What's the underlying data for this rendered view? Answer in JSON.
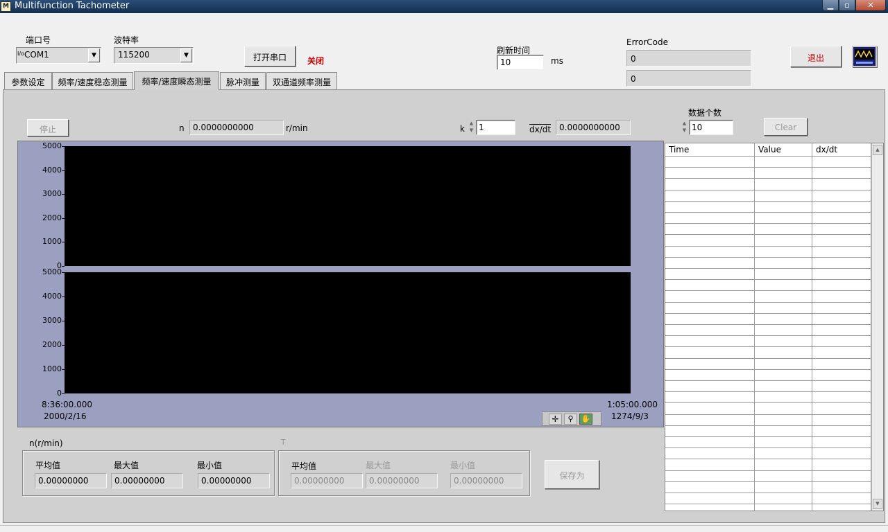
{
  "window": {
    "title": "Multifunction Tachometer",
    "icon_text": "M"
  },
  "colors": {
    "titlebar": "#1c3a5f",
    "chart_frame": "#9ba0c0",
    "plot_bg": "#000000",
    "alert_red": "#cc0000"
  },
  "port": {
    "port_label": "端口号",
    "port_prefix": "I/o",
    "port_value": "COM1",
    "baud_label": "波特率",
    "baud_value": "115200",
    "open_button": "打开串口",
    "status": "关闭"
  },
  "refresh": {
    "label": "刷新时间",
    "value": "10",
    "unit": "ms"
  },
  "error": {
    "label": "ErrorCode",
    "value1": "0",
    "value2": "0"
  },
  "exit_button": "退出",
  "tabs": [
    {
      "label": "参数设定"
    },
    {
      "label": "频率/速度稳态测量"
    },
    {
      "label": "频率/速度瞬态测量"
    },
    {
      "label": "脉冲测量"
    },
    {
      "label": "双通道频率测量"
    }
  ],
  "controls": {
    "stop_button": "停止",
    "n_label": "n",
    "n_value": "0.0000000000",
    "n_unit": "r/min",
    "k_label": "k",
    "k_value": "1",
    "dxdt_label": "dx/dt",
    "dxdt_value": "0.0000000000",
    "count_label": "数据个数",
    "count_value": "10",
    "clear_button": "Clear"
  },
  "chart_data": [
    {
      "type": "line",
      "ylim": [
        0,
        5000
      ],
      "yticks": [
        "5000",
        "4000",
        "3000",
        "2000",
        "1000",
        "0"
      ],
      "series": []
    },
    {
      "type": "line",
      "ylim": [
        0,
        5000
      ],
      "yticks": [
        "5000",
        "4000",
        "3000",
        "2000",
        "1000",
        "0"
      ],
      "x_start": "8:36:00.000",
      "x_start_date": "2000/2/16",
      "x_end": "1:05:00.000",
      "x_end_date": "1274/9/3",
      "series": []
    }
  ],
  "table": {
    "columns": [
      "Time",
      "Value",
      "dx/dt"
    ],
    "rows": []
  },
  "stats_n": {
    "title": "n(r/min)",
    "avg_label": "平均值",
    "avg": "0.00000000",
    "max_label": "最大值",
    "max": "0.00000000",
    "min_label": "最小值",
    "min": "0.00000000"
  },
  "stats_t": {
    "title": "T",
    "avg_label": "平均值",
    "avg": "0.00000000",
    "max_label": "最大值",
    "max": "0.00000000",
    "min_label": "最小值",
    "min": "0.00000000"
  },
  "save_button": "保存为"
}
